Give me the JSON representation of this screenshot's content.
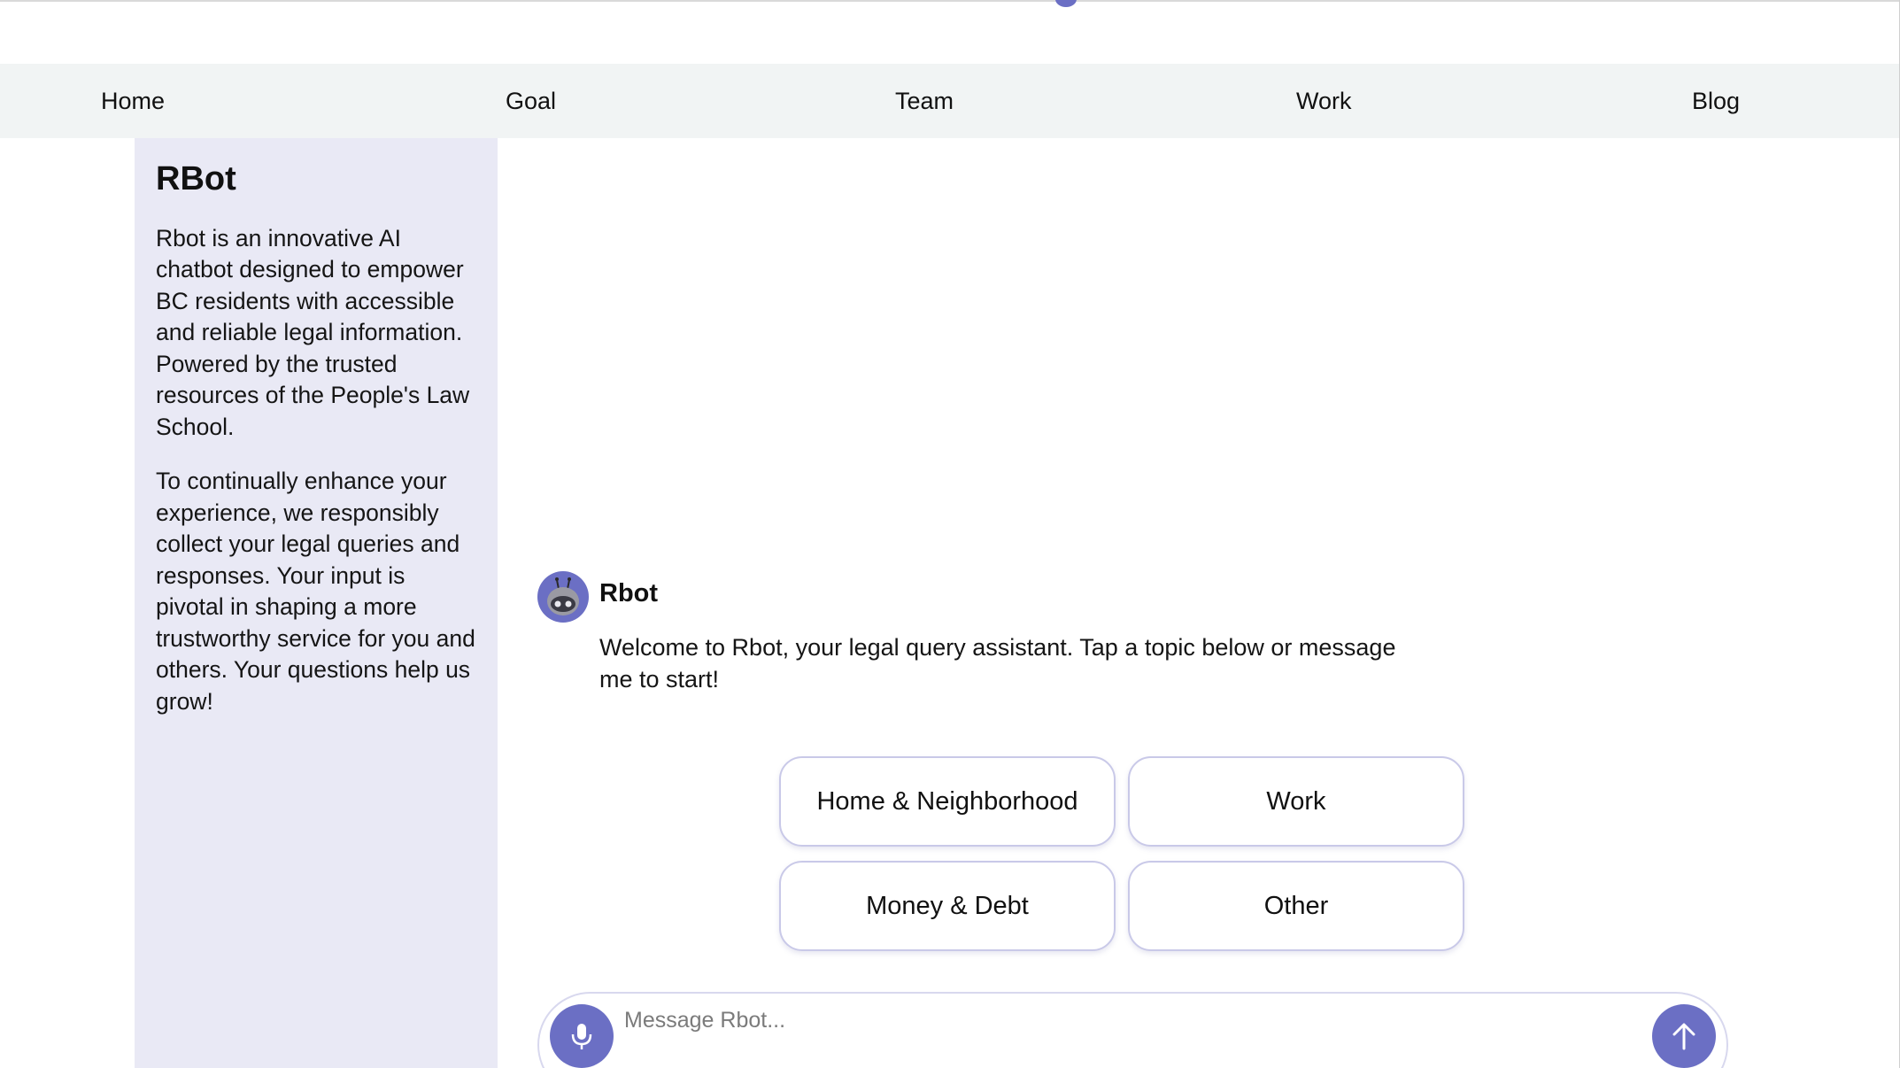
{
  "nav": {
    "items": [
      {
        "label": "Home"
      },
      {
        "label": "Goal"
      },
      {
        "label": "Team"
      },
      {
        "label": "Work"
      },
      {
        "label": "Blog"
      }
    ]
  },
  "sidebar": {
    "title": "RBot",
    "paragraphs": [
      "Rbot is an innovative AI chatbot designed to empower BC residents with accessible and reliable legal information. Powered by the trusted resources of the People's Law School.",
      "To continually enhance your experience, we responsibly collect your legal queries and responses. Your input is pivotal in shaping a more trustworthy service for you and others. Your questions help us grow!"
    ]
  },
  "chat": {
    "bot_name": "Rbot",
    "avatar_icon": "robot-icon",
    "welcome_message": "Welcome to Rbot, your legal query assistant. Tap a topic below or message me to start!",
    "topics": [
      {
        "label": "Home & Neighborhood"
      },
      {
        "label": "Work"
      },
      {
        "label": "Money & Debt"
      },
      {
        "label": "Other"
      }
    ]
  },
  "composer": {
    "placeholder": "Message Rbot...",
    "value": "",
    "mic_icon": "microphone-icon",
    "send_icon": "arrow-up-icon"
  },
  "colors": {
    "accent": "#6b6fc4",
    "nav_background": "#f1f4f4",
    "sidebar_background": "#e9e9f5",
    "topic_border": "#c9c9e8"
  }
}
